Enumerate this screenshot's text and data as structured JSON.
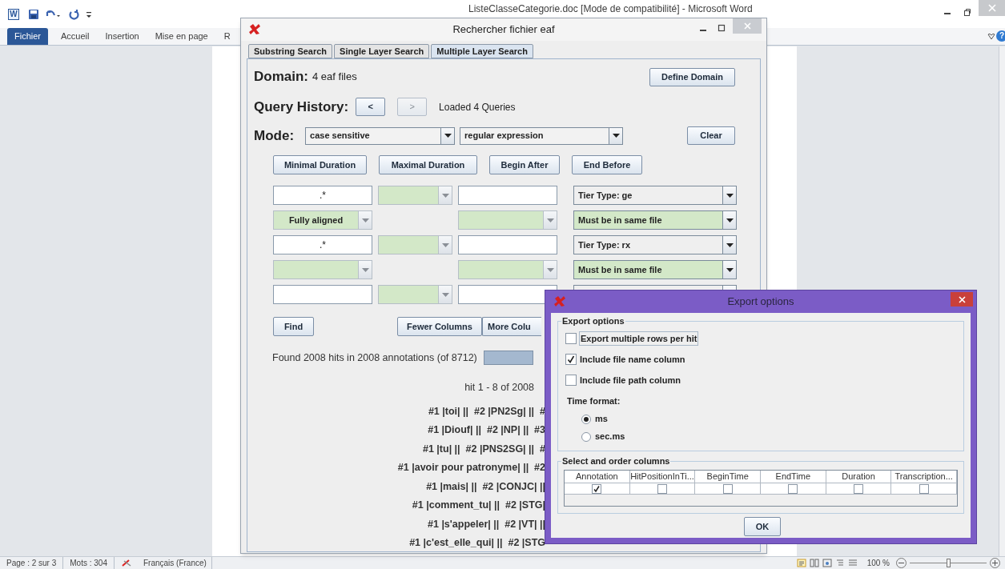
{
  "word": {
    "app_icon": "W",
    "help_icon": "?",
    "title": "ListeClasseCategorie.doc [Mode de compatibilité] - Microsoft Word",
    "ribbon_tabs": [
      {
        "label": "Fichier",
        "selected": true
      },
      {
        "label": "Accueil",
        "selected": false
      },
      {
        "label": "Insertion",
        "selected": false
      },
      {
        "label": "Mise en page",
        "selected": false
      },
      {
        "label": "R",
        "selected": false
      }
    ],
    "status_bar": {
      "page": "Page : 2 sur 3",
      "words": "Mots : 304",
      "language": "Français (France)",
      "zoom": "100 %",
      "zoom_slider": {
        "level": 0.5
      }
    }
  },
  "search_dialog": {
    "title": "Rechercher fichier eaf",
    "tabs": [
      {
        "label": "Substring Search",
        "selected": false
      },
      {
        "label": "Single Layer Search",
        "selected": false
      },
      {
        "label": "Multiple Layer Search",
        "selected": true
      }
    ],
    "domain_label": "Domain:",
    "domain_value": "4 eaf files",
    "define_domain_button": "Define Domain",
    "query_history_label": "Query History:",
    "history_buttons": [
      {
        "label": "<",
        "disabled": false
      },
      {
        "label": ">",
        "disabled": true
      }
    ],
    "history_status": "Loaded 4 Queries",
    "mode_label": "Mode:",
    "mode_combos": [
      "case sensitive",
      "regular expression"
    ],
    "clear_button": "Clear",
    "duration_buttons": [
      "Minimal Duration",
      "Maximal Duration",
      "Begin After",
      "End Before"
    ],
    "grid_rows": [
      [
        {
          "kind": "field",
          "value": ".*"
        },
        {
          "kind": "option"
        },
        {
          "kind": "field"
        },
        {
          "kind": "tier",
          "value": "Tier Type: ge"
        }
      ],
      [
        {
          "kind": "option",
          "value": "Fully aligned"
        },
        {
          "kind": "gap"
        },
        {
          "kind": "option"
        },
        {
          "kind": "constraint",
          "value": "Must be in same file"
        }
      ],
      [
        {
          "kind": "field",
          "value": ".*"
        },
        {
          "kind": "option"
        },
        {
          "kind": "field"
        },
        {
          "kind": "tier",
          "value": "Tier Type: rx"
        }
      ],
      [
        {
          "kind": "option"
        },
        {
          "kind": "gap"
        },
        {
          "kind": "option"
        },
        {
          "kind": "constraint",
          "value": "Must be in same file"
        }
      ],
      [
        {
          "kind": "field"
        },
        {
          "kind": "option"
        },
        {
          "kind": "field"
        },
        {
          "kind": "tier"
        }
      ]
    ],
    "find_button": "Find",
    "fewer_columns_button": "Fewer Columns",
    "more_columns_button": "More Colu",
    "results_summary": "Found 2008 hits in 2008 annotations (of 8712)",
    "progress": {
      "level": 1
    },
    "hits_range": "hit 1 - 8 of 2008",
    "result_lines": [
      "#1 |toi| ||  #2 |PN2Sg| ||  #",
      "#1 |Diouf| ||  #2 |NP| ||  #3",
      "#1 |tu| ||  #2 |PNS2SG| ||  #",
      "#1 |avoir pour patronyme| ||  #2",
      "#1 |mais| ||  #2 |CONJC| ||",
      "#1 |comment_tu| ||  #2 |STG|",
      "#1 |s'appeler| ||  #2 |VT| ||",
      "#1 |c'est_elle_qui| ||  #2 |STG"
    ]
  },
  "export_dialog": {
    "title": "Export options",
    "options_group": "Export options",
    "checkboxes": [
      {
        "label": "Export multiple rows per hit",
        "checked": false
      },
      {
        "label": "Include file name column",
        "checked": true
      },
      {
        "label": "Include file path column",
        "checked": false
      }
    ],
    "time_format_label": "Time format:",
    "time_formats": [
      {
        "label": "ms",
        "selected": true
      },
      {
        "label": "sec.ms",
        "selected": false
      }
    ],
    "columns_group": "Select and order columns",
    "columns": [
      {
        "label": "Annotation",
        "checked": true
      },
      {
        "label": "HitPositionInTi...",
        "checked": false
      },
      {
        "label": "BeginTime",
        "checked": false
      },
      {
        "label": "EndTime",
        "checked": false
      },
      {
        "label": "Duration",
        "checked": false
      },
      {
        "label": "Transcription...",
        "checked": false
      }
    ],
    "ok_button": "OK"
  }
}
